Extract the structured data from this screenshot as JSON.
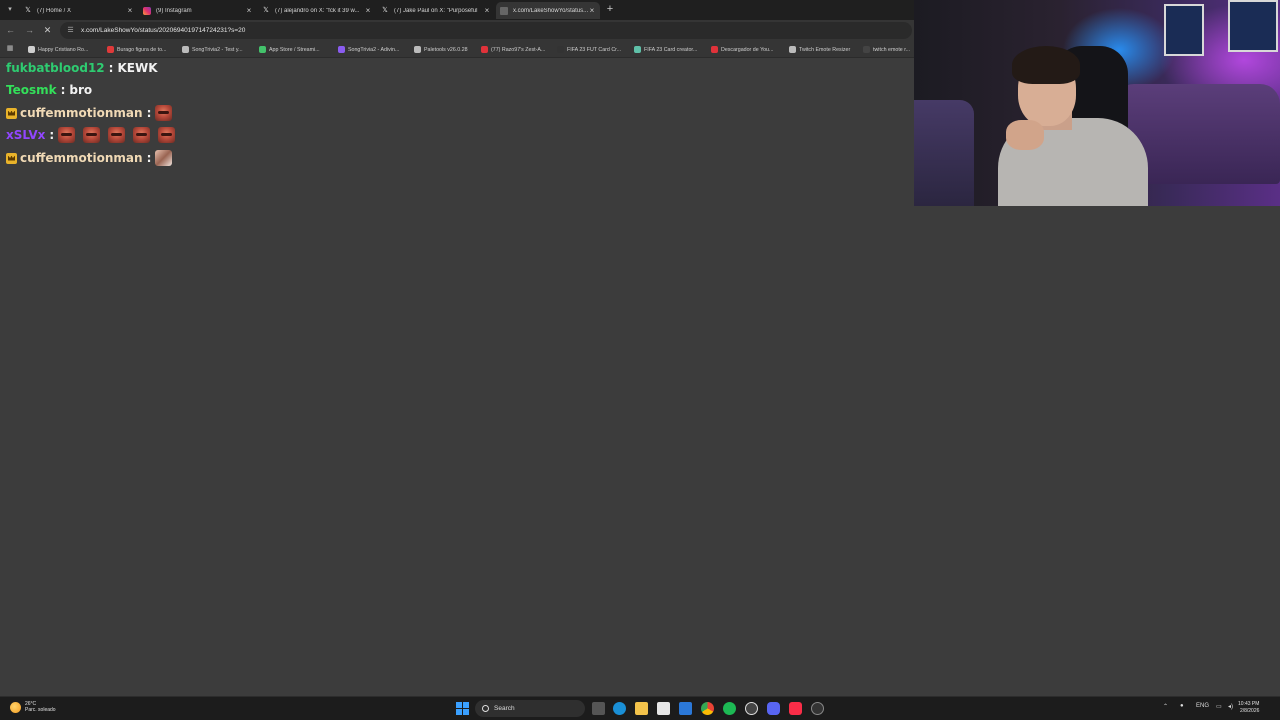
{
  "browser": {
    "tabs": [
      {
        "title": "(7) Home / X",
        "icon": "x-icon",
        "active": false
      },
      {
        "title": "(9) Instagram",
        "icon": "instagram-icon",
        "active": false
      },
      {
        "title": "(7) alejandro on X: \"fck it 39 w...",
        "icon": "x-icon",
        "active": false
      },
      {
        "title": "(7) Jake Paul on X: \"Purposeful",
        "icon": "x-icon",
        "active": false
      },
      {
        "title": "x.com/LakeShowYo/status...",
        "icon": "page-icon",
        "active": true
      }
    ],
    "close_glyph": "×",
    "new_tab_glyph": "+",
    "url": "x.com/LakeShowYo/status/2020694019714724231?s=20",
    "nav": {
      "back": "←",
      "forward": "→",
      "reload": "✕"
    }
  },
  "bookmarks": [
    {
      "label": "Happy Cristiano Ro...",
      "color": "#cfcfcf"
    },
    {
      "label": "Burago figura de to...",
      "color": "#e03a3a"
    },
    {
      "label": "SongTrivia2 - Test y...",
      "color": "#bbbbbb"
    },
    {
      "label": "App Store / Streami...",
      "color": "#43c26b"
    },
    {
      "label": "SongTrivia2 - Adivin...",
      "color": "#8a5cf0"
    },
    {
      "label": "Paletools v26.0.28",
      "color": "#bbbbbb"
    },
    {
      "label": "(77) Razo97's Zest-A...",
      "color": "#e0323a"
    },
    {
      "label": "FIFA 23 FUT Card Cr...",
      "color": "#333333"
    },
    {
      "label": "FIFA 23 Card creator...",
      "color": "#5fc0a8"
    },
    {
      "label": "Descargador de You...",
      "color": "#e0323a"
    },
    {
      "label": "Twitch Emote Resizer",
      "color": "#bbbbbb"
    },
    {
      "label": "twitch emote r...",
      "color": "#444444"
    }
  ],
  "chat": [
    {
      "user": "fukbatblood12",
      "color": "#2ecc71",
      "sep": ":",
      "text": "KEWK",
      "badge": false,
      "emotes": 0
    },
    {
      "user": "Teosmk",
      "color": "#33e05a",
      "sep": ":",
      "text": "bro",
      "badge": false,
      "emotes": 0
    },
    {
      "user": "cuffemmotionman",
      "color": "#f0d9b5",
      "sep": ":",
      "text": "",
      "badge": true,
      "emotes": 1
    },
    {
      "user": "xSLVx",
      "color": "#9146ff",
      "sep": ":",
      "text": "",
      "badge": false,
      "emotes": 5
    },
    {
      "user": "cuffemmotionman",
      "color": "#f0d9b5",
      "sep": ":",
      "text": "",
      "badge": true,
      "emotes": 1
    }
  ],
  "taskbar": {
    "weather_temp": "26°C",
    "weather_desc": "Parc. soleado",
    "search_label": "Search",
    "lang": "ENG",
    "time": "10:43 PM",
    "date": "2/8/2026"
  },
  "colors": {
    "page_bg": "#3c3c3c",
    "tabbar_bg": "#1f1f1f",
    "toolbar_bg": "#353535",
    "taskbar_bg": "#1c1c1c"
  }
}
